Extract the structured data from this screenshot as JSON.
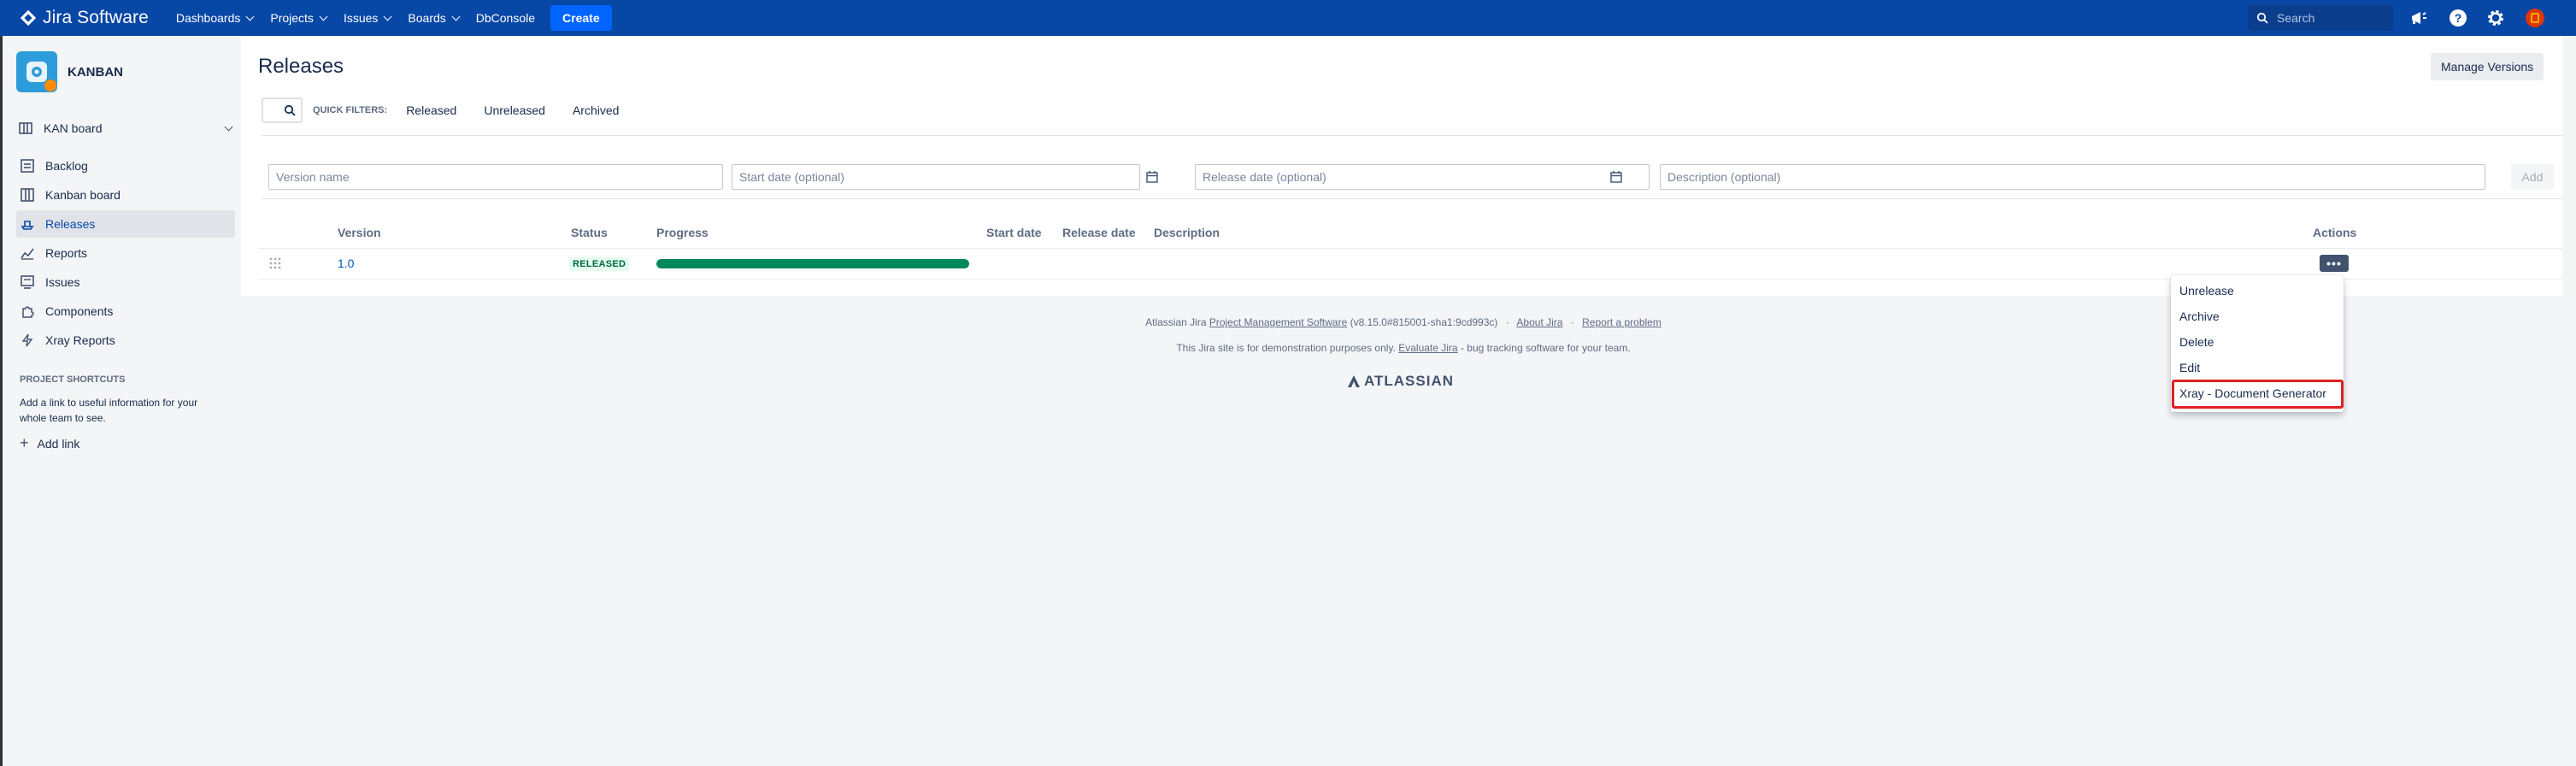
{
  "topnav": {
    "product": "Jira Software",
    "menu": [
      {
        "label": "Dashboards",
        "dropdown": true
      },
      {
        "label": "Projects",
        "dropdown": true
      },
      {
        "label": "Issues",
        "dropdown": true
      },
      {
        "label": "Boards",
        "dropdown": true
      },
      {
        "label": "DbConsole",
        "dropdown": false
      }
    ],
    "create_label": "Create",
    "search_placeholder": "Search",
    "brand_color": "#0747a6"
  },
  "sidebar": {
    "project_name": "KANBAN",
    "board_selector": "KAN board",
    "items": [
      {
        "label": "Backlog",
        "icon": "backlog-icon"
      },
      {
        "label": "Kanban board",
        "icon": "board-icon"
      },
      {
        "label": "Releases",
        "icon": "ship-icon",
        "active": true
      },
      {
        "label": "Reports",
        "icon": "chart-icon"
      },
      {
        "label": "Issues",
        "icon": "issues-icon"
      },
      {
        "label": "Components",
        "icon": "puzzle-icon"
      },
      {
        "label": "Xray Reports",
        "icon": "lightning-icon"
      }
    ],
    "shortcuts_title": "PROJECT SHORTCUTS",
    "shortcuts_help": "Add a link to useful information for your whole team to see.",
    "add_link": "Add link"
  },
  "main": {
    "title": "Releases",
    "manage_versions": "Manage Versions",
    "quick_filters_label": "QUICK FILTERS:",
    "quick_filters": [
      "Released",
      "Unreleased",
      "Archived"
    ],
    "form": {
      "version_name": "Version name",
      "start_date": "Start date (optional)",
      "release_date": "Release date (optional)",
      "description": "Description (optional)",
      "add": "Add"
    },
    "table": {
      "headers": [
        "Version",
        "Status",
        "Progress",
        "Start date",
        "Release date",
        "Description",
        "Actions"
      ],
      "rows": [
        {
          "version": "1.0",
          "status": "RELEASED",
          "progress": 1.0,
          "start_date": "",
          "release_date": "",
          "description": ""
        }
      ],
      "actions_button": "•••"
    },
    "actions_menu": [
      "Unrelease",
      "Archive",
      "Delete",
      "Edit",
      "Xray - Document Generator"
    ]
  },
  "footer": {
    "line1_prefix": "Atlassian Jira",
    "line1_link": "Project Management Software",
    "line1_version": "(v8.15.0#815001-sha1:9cd993c)",
    "about": "About Jira",
    "report": "Report a problem",
    "line2_prefix": "This Jira site is for demonstration purposes only.",
    "line2_link": "Evaluate Jira",
    "line2_suffix": "- bug tracking software for your team.",
    "brand": "ATLASSIAN"
  }
}
